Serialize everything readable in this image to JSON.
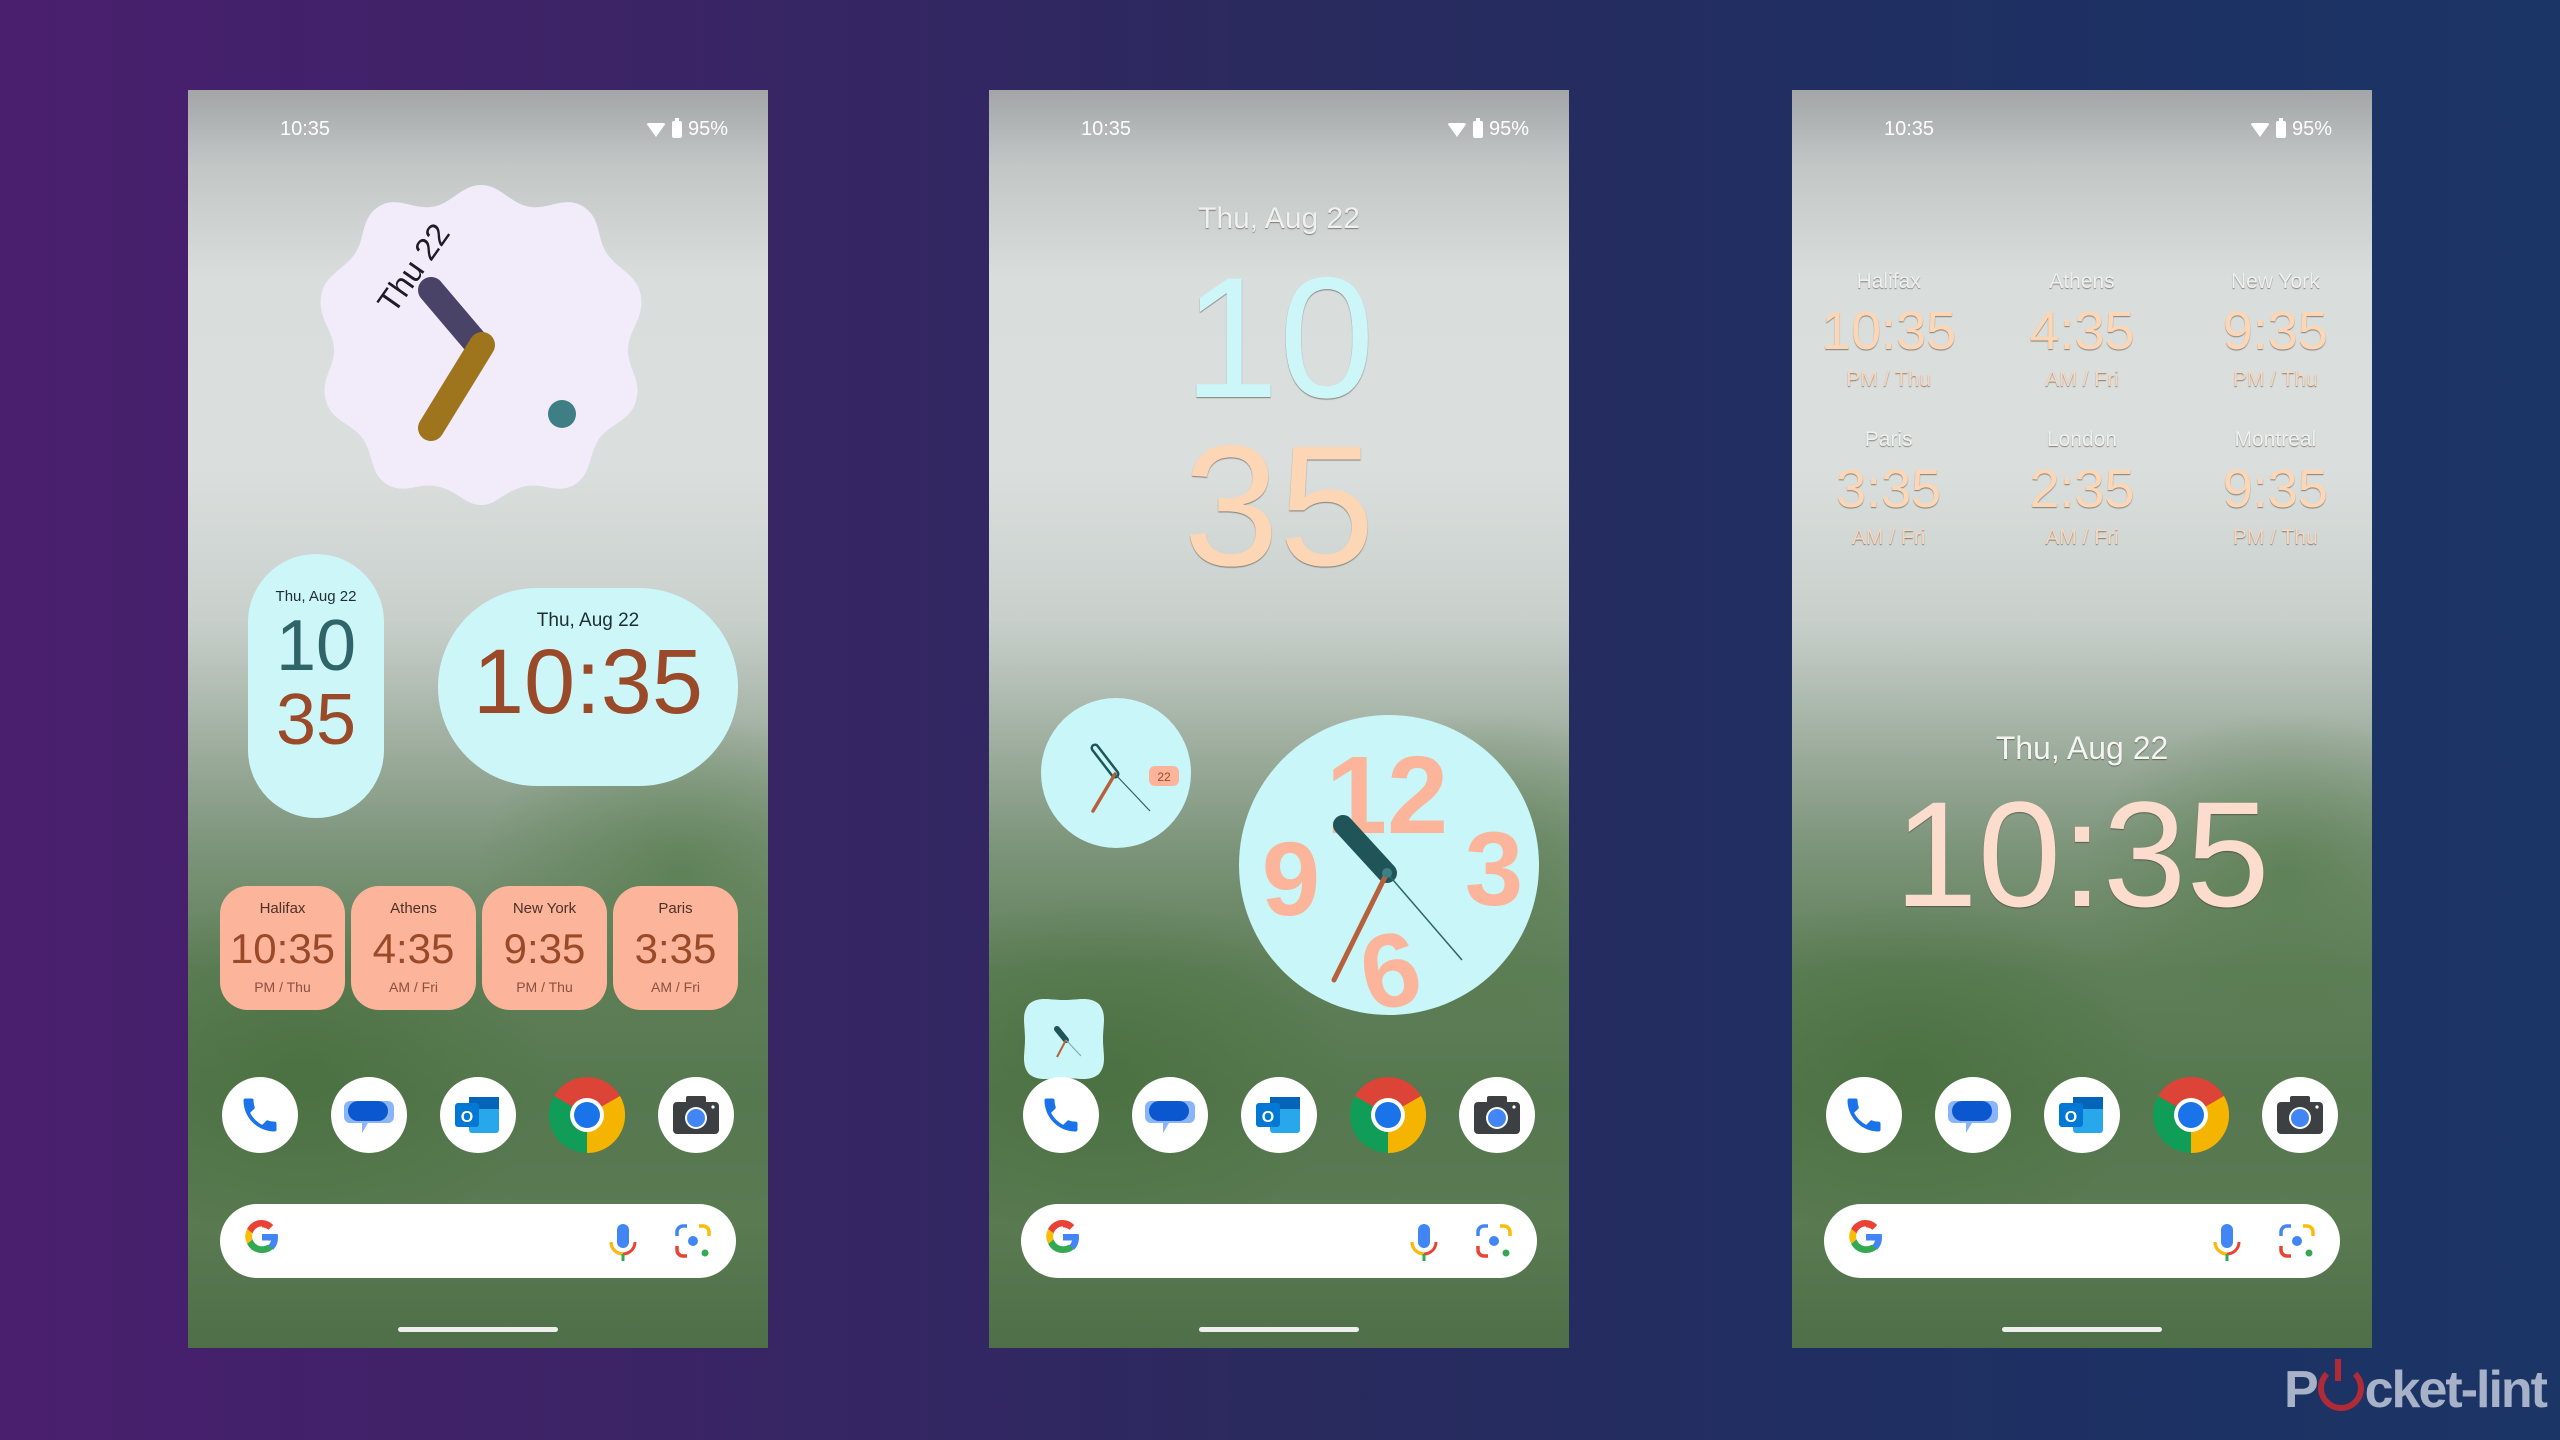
{
  "status_bar": {
    "time": "10:35",
    "battery": "95%"
  },
  "phone1": {
    "analog_widget": {
      "date_label": "Thu 22",
      "hour_hand_color": "#4a4368",
      "minute_hand_color": "#9e751c",
      "dot_color": "#3d7f85"
    },
    "pill_clock": {
      "date": "Thu, Aug 22",
      "hour": "10",
      "minute": "35"
    },
    "oval_clock": {
      "date": "Thu, Aug 22",
      "time": "10:35"
    },
    "world_clocks": [
      {
        "city": "Halifax",
        "time": "10:35",
        "sub": "PM / Thu"
      },
      {
        "city": "Athens",
        "time": "4:35",
        "sub": "AM / Fri"
      },
      {
        "city": "New York",
        "time": "9:35",
        "sub": "PM / Thu"
      },
      {
        "city": "Paris",
        "time": "3:35",
        "sub": "AM / Fri"
      }
    ]
  },
  "phone2": {
    "date": "Thu, Aug 22",
    "hour": "10",
    "minute": "35",
    "small_clock_date_badge": "22",
    "big_clock_numerals": [
      "12",
      "3",
      "6",
      "9"
    ]
  },
  "phone3": {
    "world_clocks": [
      {
        "city": "Halifax",
        "time": "10:35",
        "sub": "PM / Thu"
      },
      {
        "city": "Athens",
        "time": "4:35",
        "sub": "AM / Fri"
      },
      {
        "city": "New York",
        "time": "9:35",
        "sub": "PM / Thu"
      },
      {
        "city": "Paris",
        "time": "3:35",
        "sub": "AM / Fri"
      },
      {
        "city": "London",
        "time": "2:35",
        "sub": "AM / Fri"
      },
      {
        "city": "Montreal",
        "time": "9:35",
        "sub": "PM / Thu"
      }
    ],
    "date": "Thu, Aug 22",
    "time": "10:35"
  },
  "dock_apps": [
    "Phone",
    "Messages",
    "Outlook",
    "Chrome",
    "Camera"
  ],
  "search": {
    "logo": "G"
  },
  "watermark": {
    "prefix": "P",
    "suffix": "cket-lint"
  },
  "colors": {
    "widget_cyan": "#cdf6f8",
    "salmon": "#fcb59b",
    "rust": "#9a4a28",
    "teal_dark": "#2f6468"
  }
}
